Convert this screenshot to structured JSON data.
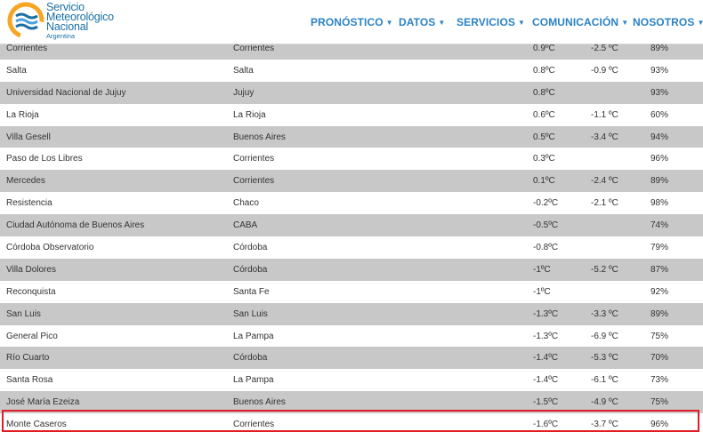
{
  "logo": {
    "line1": "Servicio",
    "line2": "Meteorológico",
    "line3": "Nacional",
    "line4": "Argentina",
    "colors": {
      "blue": "#1a6fa3",
      "orange": "#f5a623",
      "light_blue": "#4aa3df"
    }
  },
  "nav": [
    {
      "label": "PRONÓSTICO",
      "icon": "caret-down-icon"
    },
    {
      "label": "DATOS",
      "icon": "caret-down-icon"
    },
    {
      "label": "SERVICIOS",
      "icon": "caret-down-icon"
    },
    {
      "label": "COMUNICACIÓN",
      "icon": "caret-down-icon"
    },
    {
      "label": "NOSOTROS",
      "icon": "caret-down-icon"
    }
  ],
  "rows": [
    {
      "station": "Corrientes",
      "province": "Corrientes",
      "temp": "0.9ºC",
      "dew": "-2.5 ºC",
      "humidity": "89%"
    },
    {
      "station": "Salta",
      "province": "Salta",
      "temp": "0.8ºC",
      "dew": "-0.9 ºC",
      "humidity": "93%"
    },
    {
      "station": "Universidad Nacional de Jujuy",
      "province": "Jujuy",
      "temp": "0.8ºC",
      "dew": "",
      "humidity": "93%"
    },
    {
      "station": "La Rioja",
      "province": "La Rioja",
      "temp": "0.6ºC",
      "dew": "-1.1 ºC",
      "humidity": "60%"
    },
    {
      "station": "Villa Gesell",
      "province": "Buenos Aires",
      "temp": "0.5ºC",
      "dew": "-3.4 ºC",
      "humidity": "94%"
    },
    {
      "station": "Paso de Los Libres",
      "province": "Corrientes",
      "temp": "0.3ºC",
      "dew": "",
      "humidity": "96%"
    },
    {
      "station": "Mercedes",
      "province": "Corrientes",
      "temp": "0.1ºC",
      "dew": "-2.4 ºC",
      "humidity": "89%"
    },
    {
      "station": "Resistencia",
      "province": "Chaco",
      "temp": "-0.2ºC",
      "dew": "-2.1 ºC",
      "humidity": "98%"
    },
    {
      "station": "Ciudad Autónoma de Buenos Aires",
      "province": "CABA",
      "temp": "-0.5ºC",
      "dew": "",
      "humidity": "74%"
    },
    {
      "station": "Córdoba Observatorio",
      "province": "Córdoba",
      "temp": "-0.8ºC",
      "dew": "",
      "humidity": "79%"
    },
    {
      "station": "Villa Dolores",
      "province": "Córdoba",
      "temp": "-1ºC",
      "dew": "-5.2 ºC",
      "humidity": "87%"
    },
    {
      "station": "Reconquista",
      "province": "Santa Fe",
      "temp": "-1ºC",
      "dew": "",
      "humidity": "92%"
    },
    {
      "station": "San Luis",
      "province": "San Luis",
      "temp": "-1.3ºC",
      "dew": "-3.3 ºC",
      "humidity": "89%"
    },
    {
      "station": "General Pico",
      "province": "La Pampa",
      "temp": "-1.3ºC",
      "dew": "-6.9 ºC",
      "humidity": "75%"
    },
    {
      "station": "Río Cuarto",
      "province": "Córdoba",
      "temp": "-1.4ºC",
      "dew": "-5.3 ºC",
      "humidity": "70%"
    },
    {
      "station": "Santa Rosa",
      "province": "La Pampa",
      "temp": "-1.4ºC",
      "dew": "-6.1 ºC",
      "humidity": "73%"
    },
    {
      "station": "José María Ezeiza",
      "province": "Buenos Aires",
      "temp": "-1.5ºC",
      "dew": "-4.9 ºC",
      "humidity": "75%"
    },
    {
      "station": "Monte Caseros",
      "province": "Corrientes",
      "temp": "-1.6ºC",
      "dew": "-3.7 ºC",
      "humidity": "96%",
      "highlighted": true
    }
  ],
  "highlight_color": "#e21b24"
}
